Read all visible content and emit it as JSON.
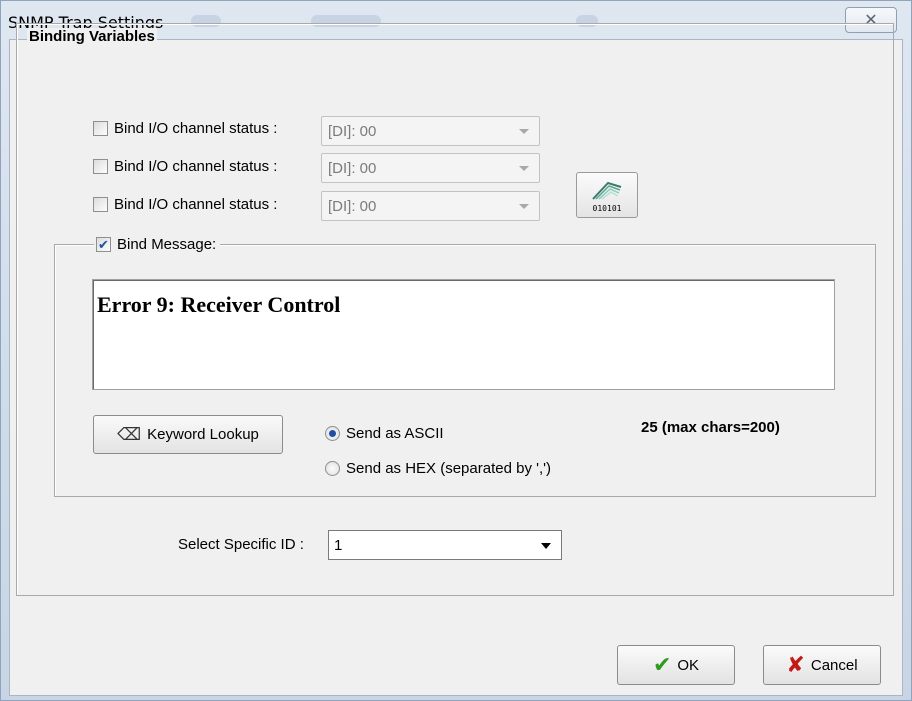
{
  "window": {
    "title": "SNMP Trap Settings",
    "close_glyph": "✕"
  },
  "binding": {
    "legend": "Binding Variables",
    "channels": [
      {
        "label": "Bind I/O channel status :",
        "checked": false,
        "value": "[DI]: 00"
      },
      {
        "label": "Bind I/O channel status :",
        "checked": false,
        "value": "[DI]: 00"
      },
      {
        "label": "Bind I/O channel status :",
        "checked": false,
        "value": "[DI]: 00"
      }
    ],
    "binary_icon_text": "010101",
    "message": {
      "legend": "Bind Message:",
      "checked": true,
      "text": "Error 9: Receiver Control",
      "keyword_button": "Keyword Lookup",
      "send_ascii": "Send as ASCII",
      "send_hex": "Send as HEX (separated by ',')",
      "selected_mode": "ascii",
      "char_count": "25 (max chars=200)"
    }
  },
  "specific_id": {
    "label": "Select Specific ID :",
    "value": "1"
  },
  "footer": {
    "ok_label": "OK",
    "cancel_label": "Cancel"
  },
  "icons": {
    "ok": "check-icon",
    "cancel": "x-icon",
    "keyword": "eraser-icon",
    "binary": "binary-data-icon"
  }
}
